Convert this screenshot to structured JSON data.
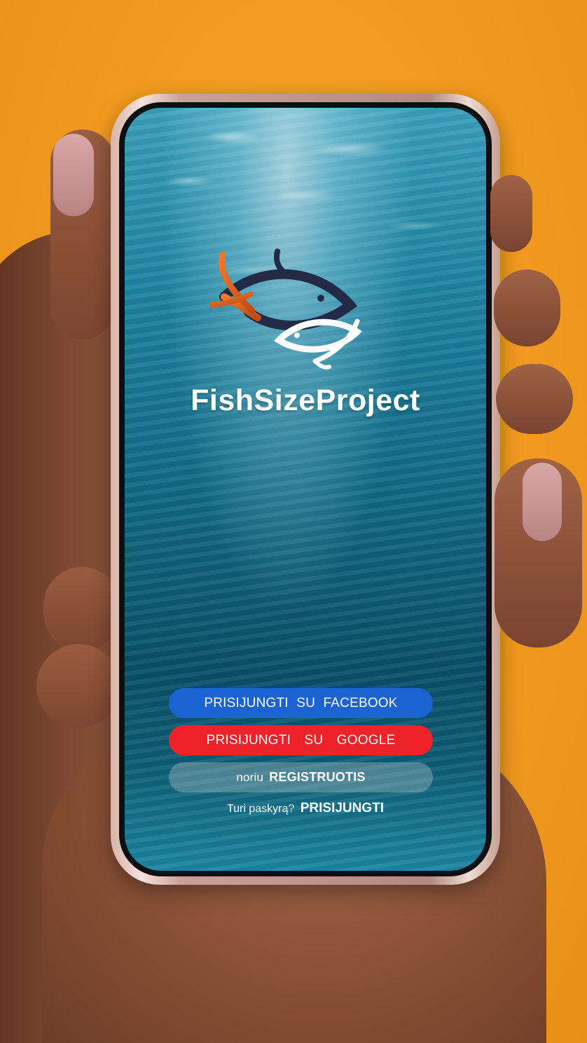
{
  "app": {
    "title": "FishSizeProject"
  },
  "buttons": {
    "facebook": "PRISIJUNGTI SU FACEBOOK",
    "google": "PRISIJUNGTI SU GOOGLE",
    "register_prefix": "noriu",
    "register_action": "REGISTRUOTIS"
  },
  "login": {
    "prompt": "Turi paskyrą?",
    "action": "PRISIJUNGTI"
  },
  "colors": {
    "background": "#f19a1f",
    "facebook": "#1a63d1",
    "google": "#ee2229",
    "water": "#136e8a"
  },
  "icons": {
    "logo": "two-fish-logo-icon"
  }
}
